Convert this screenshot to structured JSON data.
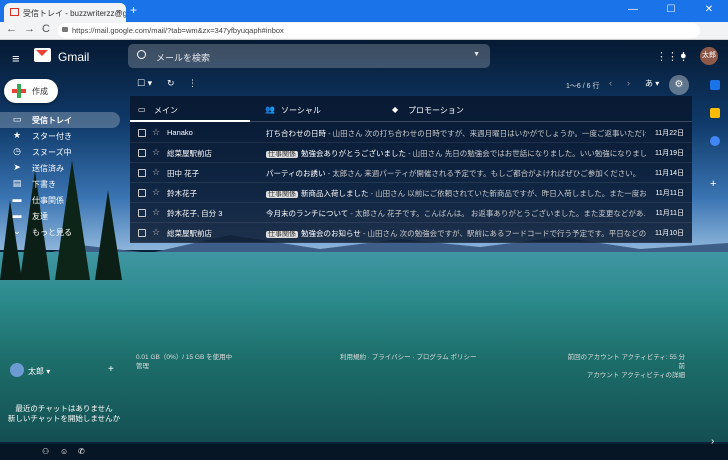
{
  "browser": {
    "tab_title": "受信トレイ - buzzwriterzz@gmail.c",
    "tab_close": "×",
    "new_tab": "+",
    "url": "https://mail.google.com/mail/?tab=wm&zx=347yfbyuqaph#inbox",
    "back": "←",
    "forward": "→",
    "reload": "C",
    "min": "—",
    "max": "☐",
    "close": "✕"
  },
  "header": {
    "menu": "≡",
    "app": "Gmail",
    "search_placeholder": "メールを検索",
    "search_dropdown": "▼",
    "apps": "⋮⋮⋮",
    "notify": "●",
    "avatar": "太郎"
  },
  "compose": {
    "label": "作成"
  },
  "sidebar": {
    "items": [
      {
        "icon": "▭",
        "label": "受信トレイ",
        "active": true
      },
      {
        "icon": "★",
        "label": "スター付き"
      },
      {
        "icon": "◷",
        "label": "スヌーズ中"
      },
      {
        "icon": "➤",
        "label": "送信済み"
      },
      {
        "icon": "▤",
        "label": "下書き"
      },
      {
        "icon": "▬",
        "label": "仕事関係"
      },
      {
        "icon": "▬",
        "label": "友達"
      },
      {
        "icon": "⌄",
        "label": "もっと見る"
      }
    ]
  },
  "hangout": {
    "user": "太郎 ▾",
    "add": "+",
    "nochat_line1": "最近のチャットはありません",
    "nochat_line2": "新しいチャットを開始しませんか"
  },
  "bottombar": {
    "icons": [
      "⚇",
      "☺",
      "✆"
    ]
  },
  "toolbar": {
    "select": "☐ ▾",
    "refresh": "↻",
    "more": "⋮",
    "pager": "1～6 / 6 行",
    "prev": "‹",
    "next": "›",
    "lang": "あ ▾",
    "settings": "⚙"
  },
  "tabs": [
    {
      "icon": "▭",
      "label": "メイン",
      "active": true
    },
    {
      "icon": "👥",
      "label": "ソーシャル"
    },
    {
      "icon": "◆",
      "label": "プロモーション"
    }
  ],
  "emails": [
    {
      "sender": "Hanako",
      "label": "",
      "subject": "打ち合わせの日時",
      "snippet": " - 山田さん 次の打ち合わせの日時ですが、来週月曜日はいかがでしょうか。一度ご返事いただけ...",
      "date": "11月22日"
    },
    {
      "sender": "総菜屋駅前店",
      "label": "仕事関係",
      "subject": "勉強会ありがとうございました",
      "snippet": " - 山田さん 先日の勉強会ではお世話になりました。いい勉強になりまし...",
      "date": "11月19日"
    },
    {
      "sender": "田中 花子",
      "label": "",
      "subject": "パーティのお誘い",
      "snippet": " - 太郎さん 来週パーティが開催される予定です。もしご都合がよければぜひご参加ください。",
      "date": "11月14日"
    },
    {
      "sender": "鈴木花子",
      "label": "仕事関係",
      "subject": "新商品入荷しました",
      "snippet": " - 山田さん 以前にご依頼されていた新商品ですが、昨日入荷しました。また一度お...",
      "date": "11月11日"
    },
    {
      "sender": "鈴木花子, 自分 3",
      "label": "",
      "subject": "今月末のランチについて",
      "snippet": " - 太郎さん 花子です。こんばんは。 お返事ありがとうございました。また変更などがあ...",
      "date": "11月11日"
    },
    {
      "sender": "総菜屋駅前店",
      "label": "仕事関係",
      "subject": "勉強会のお知らせ",
      "snippet": " - 山田さん 次の勉強会ですが、駅前にあるフードコードで行う予定です。平日などの時間...",
      "date": "11月10日"
    }
  ],
  "footer": {
    "storage_line1": "0.01 GB（0%）/ 15 GB を使用中",
    "storage_line2": "管理",
    "policy": "利用規約 · プライバシー · プログラム ポリシー",
    "activity_line1": "前回のアカウント アクティビティ: 55 分前",
    "activity_line2": "アカウント アクティビティの詳細"
  },
  "rightbar": {
    "add": "+",
    "collapse": "›"
  }
}
